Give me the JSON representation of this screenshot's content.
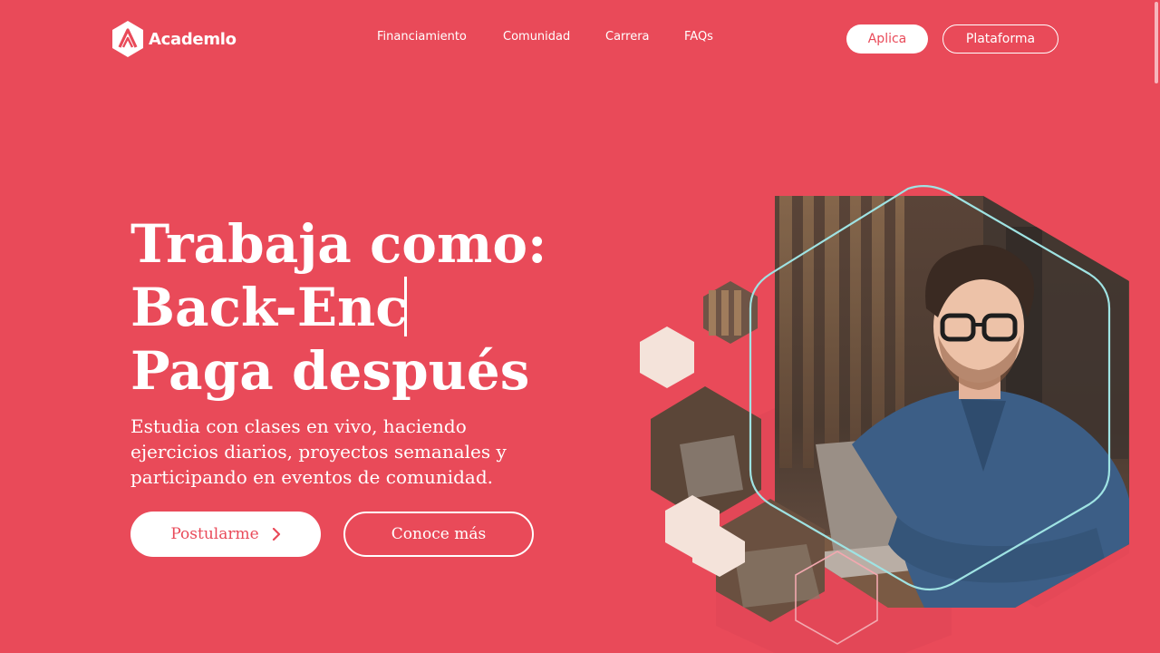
{
  "brand": {
    "name": "Academlo"
  },
  "nav": {
    "links": [
      "Financiamiento",
      "Comunidad",
      "Carrera",
      "FAQs"
    ]
  },
  "header_buttons": {
    "apply": "Aplica",
    "platform": "Plataforma"
  },
  "hero": {
    "title_line1": "Trabaja como:",
    "title_typed": "Back-Enc",
    "title_line3": "Paga después",
    "subtitle": "Estudia con clases en vivo, haciendo ejercicios diarios, proyectos semanales y participando en eventos de comunidad.",
    "primary_button": "Postularme",
    "secondary_button": "Conoce más"
  },
  "icons": {
    "logo": "academlo-hexagon-logo",
    "primary_button": "chevron-right-icon"
  },
  "colors": {
    "brand": "#E94A59",
    "accent_outline": "#9FE3E3",
    "hex_light": "#F4E3DA",
    "text": "#FFFFFF"
  }
}
